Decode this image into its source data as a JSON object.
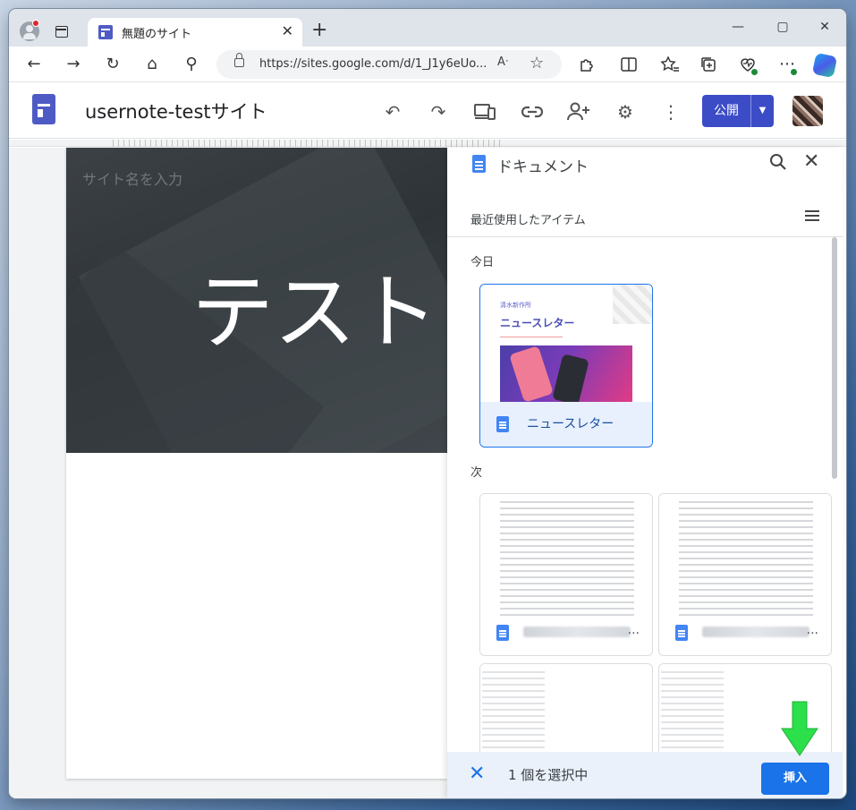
{
  "browser": {
    "tab_title": "無題のサイト",
    "tab_close": "✕",
    "new_tab": "+",
    "url": "https://sites.google.com/d/1_J1y6eUo...",
    "read_aloud": "Aᐧ",
    "window_buttons": [
      "—",
      "▢",
      "✕"
    ]
  },
  "sites": {
    "site_name": "usernote-testサイト",
    "publish_label": "公開",
    "publish_arrow": "▼"
  },
  "page": {
    "site_title_placeholder": "サイト名を入力",
    "banner_text": "テスト"
  },
  "picker": {
    "title": "ドキュメント",
    "recent_label": "最近使用したアイテム",
    "section_today": "今日",
    "section_next": "次",
    "cards_today": [
      {
        "publisher": "清水新作所",
        "thumb_title": "ニュースレター",
        "label": "ニュースレター",
        "selected": true
      }
    ],
    "more": "...",
    "selection_count": "1 個を選択中",
    "insert_label": "挿入",
    "close": "✕"
  },
  "icons": {
    "back": "←",
    "forward": "→",
    "reload": "↻",
    "home": "⌂",
    "search": "⚲",
    "undo": "↶",
    "redo": "↷",
    "more_vert": "⋮",
    "settings": "⚙",
    "link": "⚯",
    "add_user": "👤"
  },
  "colors": {
    "sites_brand": "#4f5bc4",
    "publish": "#3c4cc7",
    "insert": "#1a73e8",
    "selection_bar": "#eaf1fb",
    "annotation_arrow": "#2be04a"
  }
}
